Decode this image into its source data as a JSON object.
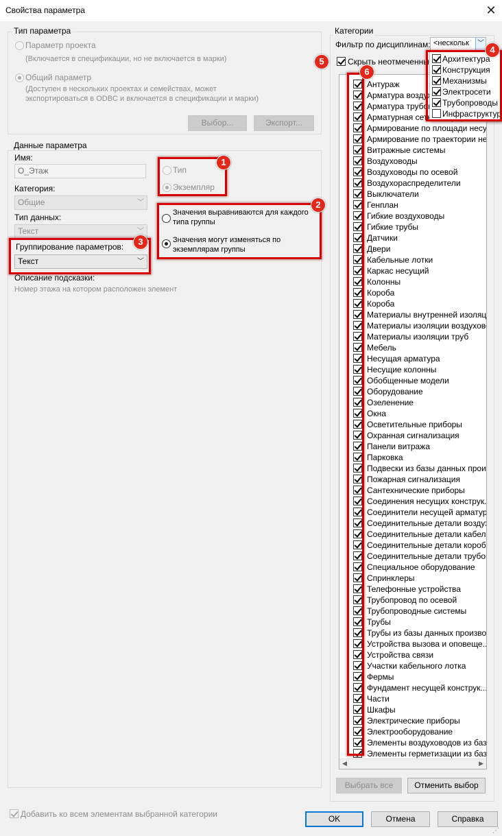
{
  "window": {
    "title": "Свойства параметра"
  },
  "param_type": {
    "group_label": "Тип параметра",
    "project_label": "Параметр проекта",
    "project_desc": "(Включается в спецификации, но не включается в марки)",
    "shared_label": "Общий параметр",
    "shared_desc_1": "(Доступен в нескольких проектах и семействах, может",
    "shared_desc_2": "экспортироваться в ODBC и включается в спецификации и марки)",
    "select_btn": "Выбор...",
    "export_btn": "Экспорт..."
  },
  "param_data": {
    "group_label": "Данные параметра",
    "name_label": "Имя:",
    "name_value": "О_Этаж",
    "category_label": "Категория:",
    "category_value": "Общие",
    "datatype_label": "Тип данных:",
    "datatype_value": "Текст",
    "grouping_label": "Группирование параметров:",
    "grouping_value": "Текст",
    "tooltip_label": "Описание подсказки:",
    "tooltip_value": "Номер этажа на котором расположен элемент",
    "type_label": "Тип",
    "instance_label": "Экземпляр",
    "align_label_1": "Значения выравниваются для каждого",
    "align_label_2": "типа группы",
    "vary_label_1": "Значения могут изменяться по",
    "vary_label_2": "экземплярам группы"
  },
  "categories": {
    "group_label": "Категории",
    "filter_label": "Фильтр по дисциплинам:",
    "filter_value": "<нескольк",
    "hide_unchecked_label": "Скрыть неотмеченные",
    "disciplines": [
      {
        "label": "Архитектура",
        "checked": true
      },
      {
        "label": "Конструкция",
        "checked": true
      },
      {
        "label": "Механизмы",
        "checked": true
      },
      {
        "label": "Электросети",
        "checked": true
      },
      {
        "label": "Трубопроводы",
        "checked": true
      },
      {
        "label": "Инфраструктура",
        "checked": false
      }
    ],
    "items": [
      "Антураж",
      "Арматура воздуховодов",
      "Арматура трубопроводов",
      "Арматурная сетка несущей конструкции",
      "Армирование по площади несущей конструкции",
      "Армирование по траектории несущей конструкции",
      "Витражные системы",
      "Воздуховоды",
      "Воздуховоды по осевой",
      "Воздухораспределители",
      "Выключатели",
      "Генплан",
      "Гибкие воздуховоды",
      "Гибкие трубы",
      "Датчики",
      "Двери",
      "Кабельные лотки",
      "Каркас несущий",
      "Колонны",
      "Короба",
      "Короба",
      "Материалы внутренней изоляции воздуховодов",
      "Материалы изоляции воздухово...",
      "Материалы изоляции труб",
      "Мебель",
      "Несущая арматура",
      "Несущие колонны",
      "Обобщенные модели",
      "Оборудование",
      "Озеленение",
      "Окна",
      "Осветительные приборы",
      "Охранная сигнализация",
      "Панели витража",
      "Парковка",
      "Подвески из базы данных производителя",
      "Пожарная сигнализация",
      "Сантехнические приборы",
      "Соединения несущих конструк...",
      "Соединители несущей арматуры",
      "Соединительные детали воздуховодов",
      "Соединительные детали кабельных лотков",
      "Соединительные детали коробов",
      "Соединительные детали трубопроводов",
      "Специальное оборудование",
      "Спринклеры",
      "Телефонные устройства",
      "Трубопровод по осевой",
      "Трубопроводные системы",
      "Трубы",
      "Трубы из базы данных производителя",
      "Устройства вызова и оповеще...",
      "Устройства связи",
      "Участки кабельного лотка",
      "Фермы",
      "Фундамент несущей конструк...",
      "Части",
      "Шкафы",
      "Электрические приборы",
      "Электрооборудование",
      "Элементы воздуховодов из базы данных",
      "Элементы герметизации из базы данных"
    ],
    "select_all_btn": "Выбрать все",
    "deselect_btn": "Отменить выбор"
  },
  "footer": {
    "add_all_label": "Добавить ко всем элементам выбранной категории",
    "ok_btn": "OK",
    "cancel_btn": "Отмена",
    "help_btn": "Справка"
  },
  "badges": [
    "1",
    "2",
    "3",
    "4",
    "5",
    "6"
  ],
  "colors": {
    "highlight": "#d60000",
    "badge": "#e2271b",
    "accent": "#0078d7"
  }
}
